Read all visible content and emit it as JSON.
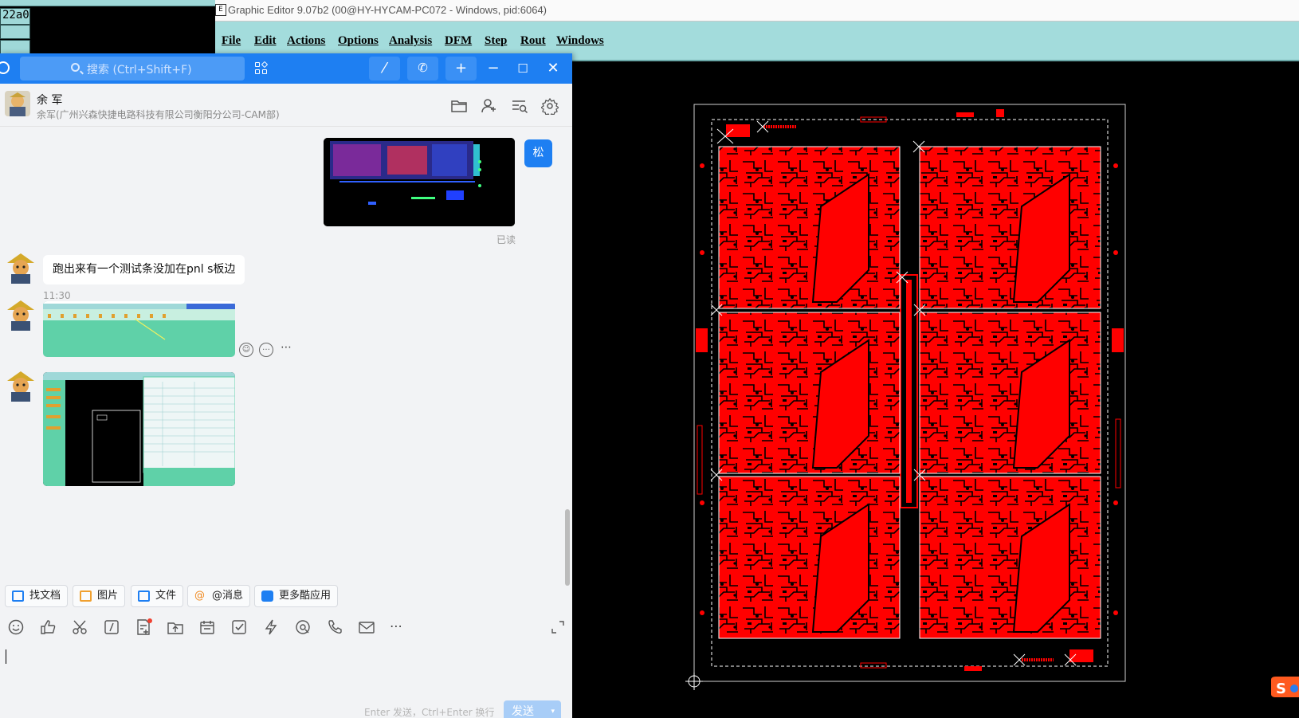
{
  "legacy_window": {
    "cell_top": "22a0"
  },
  "graphic_editor": {
    "icon_label": "E",
    "title": "Graphic Editor 9.07b2 (00@HY-HYCAM-PC072 - Windows, pid:6064)",
    "menus": [
      "File",
      "Edit",
      "Actions",
      "Options",
      "Analysis",
      "DFM",
      "Step",
      "Rout",
      "Windows"
    ],
    "board_color": "#ff0000",
    "outline_color": "#ffffff"
  },
  "chat": {
    "accent_color": "#1e7ff2",
    "search_placeholder": "搜索 (Ctrl+Shift+F)",
    "contact": {
      "name": "余 军",
      "subtitle": "余军(广州兴森快捷电路科技有限公司衡阳分公司-CAM部)"
    },
    "self_avatar_label": "松",
    "read_status": "已读",
    "message_text": "跑出来有一个测试条没加在pnl s板边",
    "timestamp": "11:30",
    "quick_actions": [
      {
        "label": "找文档",
        "icon": "find-doc-icon"
      },
      {
        "label": "图片",
        "icon": "picture-icon"
      },
      {
        "label": "文件",
        "icon": "folder-icon"
      },
      {
        "label": "@消息",
        "icon": "at-icon"
      },
      {
        "label": "更多酷应用",
        "icon": "apps-icon"
      }
    ],
    "input_hint": "Enter 发送，Ctrl+Enter 换行",
    "send_label": "发送"
  }
}
